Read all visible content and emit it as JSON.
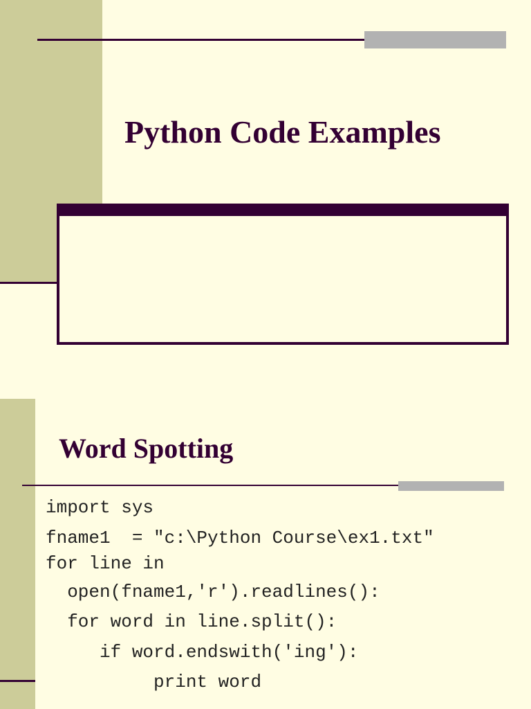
{
  "slides": [
    {
      "title": "Python Code Examples"
    },
    {
      "title": "Word Spotting",
      "code_lines": [
        "import sys",
        "fname1  = \"c:\\Python Course\\ex1.txt\"",
        "for line in",
        "  open(fname1,'r').readlines():",
        "  for word in line.split():",
        "     if word.endswith('ing'):",
        "          print word"
      ]
    }
  ],
  "colors": {
    "background": "#fffde3",
    "sidebar": "#cccc99",
    "accent": "#330033",
    "gray_bar": "#b2b2b2"
  }
}
